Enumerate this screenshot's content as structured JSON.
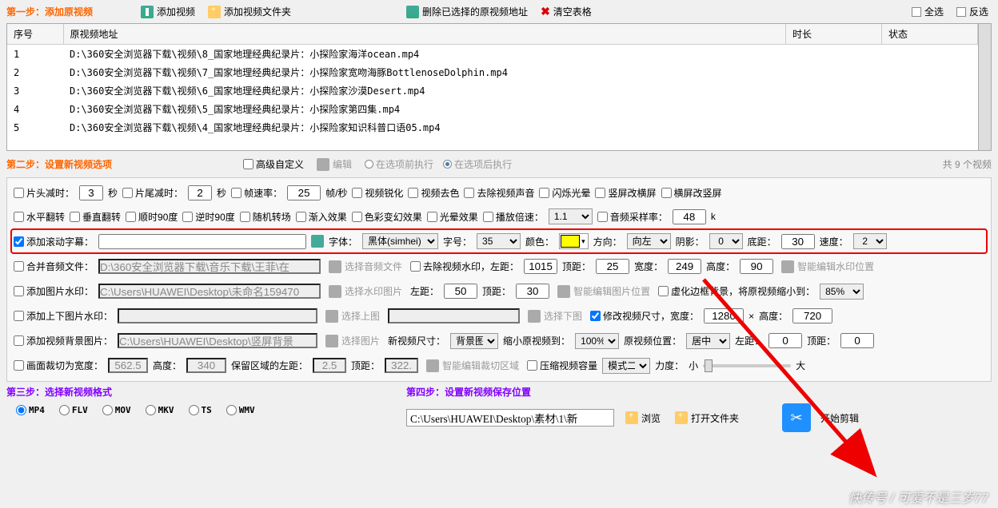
{
  "toolbar": {
    "step1": "第一步：添加原视频",
    "add_video": "添加视频",
    "add_folder": "添加视频文件夹",
    "delete_selected": "删除已选择的原视频地址",
    "clear_table": "清空表格",
    "select_all": "全选",
    "invert_sel": "反选"
  },
  "table": {
    "headers": {
      "num": "序号",
      "path": "原视频地址",
      "duration": "时长",
      "status": "状态"
    },
    "rows": [
      {
        "n": "1",
        "p": "D:\\360安全浏览器下载\\视频\\8_国家地理经典纪录片：小探险家海洋ocean.mp4"
      },
      {
        "n": "2",
        "p": "D:\\360安全浏览器下载\\视频\\7_国家地理经典纪录片：小探险家宽吻海豚BottlenoseDolphin.mp4"
      },
      {
        "n": "3",
        "p": "D:\\360安全浏览器下载\\视频\\6_国家地理经典纪录片：小探险家沙漠Desert.mp4"
      },
      {
        "n": "4",
        "p": "D:\\360安全浏览器下载\\视频\\5_国家地理经典纪录片：小探险家第四集.mp4"
      },
      {
        "n": "5",
        "p": "D:\\360安全浏览器下载\\视频\\4_国家地理经典纪录片：小探险家知识科普口语05.mp4"
      }
    ]
  },
  "step2": {
    "label": "第二步：设置新视频选项",
    "advanced": "高级自定义",
    "edit": "编辑",
    "exec_before": "在选项前执行",
    "exec_after": "在选项后执行",
    "count": "共 9 个视频"
  },
  "opts": {
    "head_trim": "片头减时：",
    "head_val": "3",
    "sec": "秒",
    "tail_trim": "片尾减时：",
    "tail_val": "2",
    "fps_lbl": "帧速率：",
    "fps_val": "25",
    "fps_unit": "帧/秒",
    "sharpen": "视频锐化",
    "desat": "视频去色",
    "mute": "去除视频声音",
    "flash": "闪烁光晕",
    "v2h": "竖屏改横屏",
    "h2v": "横屏改竖屏",
    "hflip": "水平翻转",
    "vflip": "垂直翻转",
    "cw90": "顺时90度",
    "ccw90": "逆时90度",
    "rand_trans": "随机转场",
    "in_effect": "渐入效果",
    "color_fx": "色彩变幻效果",
    "halo": "光晕效果",
    "speed_lbl": "播放倍速：",
    "speed_val": "1.1",
    "audio_rate_lbl": "音频采样率：",
    "audio_rate_val": "48",
    "audio_rate_unit": "k",
    "scroll_sub": "添加滚动字幕：",
    "font_lbl": "字体：",
    "font_val": "黑体(simhei)",
    "size_lbl": "字号：",
    "size_val": "35",
    "color_lbl": "颜色：",
    "dir_lbl": "方向：",
    "dir_val": "向左",
    "shadow_lbl": "阴影：",
    "shadow_val": "0",
    "bottom_lbl": "底距：",
    "bottom_val": "30",
    "scroll_speed_lbl": "速度：",
    "scroll_speed_val": "2",
    "merge_audio": "合并音频文件：",
    "audio_path": "D:\\360安全浏览器下载\\音乐下载\\王菲\\在",
    "sel_audio": "选择音频文件",
    "rm_wm": "去除视频水印，左距：",
    "wm_l": "1015",
    "wm_t_lbl": "顶距：",
    "wm_t": "25",
    "wm_w_lbl": "宽度：",
    "wm_w": "249",
    "wm_h_lbl": "高度：",
    "wm_h": "90",
    "smart_wm": "智能编辑水印位置",
    "img_wm": "添加图片水印：",
    "img_wm_path": "C:\\Users\\HUAWEI\\Desktop\\未命名159470",
    "sel_wm_img": "选择水印图片",
    "left_lbl": "左距：",
    "left_v": "50",
    "top_v": "30",
    "smart_img": "智能编辑图片位置",
    "blur_bg": "虚化边框背景，将原视频缩小到：",
    "blur_pct": "85%",
    "tb_img_wm": "添加上下图片水印：",
    "sel_top": "选择上图",
    "sel_bot": "选择下图",
    "resize": "修改视频尺寸，宽度：",
    "rw": "1280",
    "x": "×",
    "rh_lbl": "高度：",
    "rh": "720",
    "bg_img": "添加视频背景图片：",
    "bg_path": "C:\\Users\\HUAWEI\\Desktop\\竖屏背景",
    "sel_img": "选择图片",
    "new_size": "新视频尺寸：",
    "bg_sel": "背景图",
    "shrink": "缩小原视频到：",
    "shrink_v": "100%",
    "orig_pos": "原视频位置：",
    "center": "居中",
    "l2": "左距：",
    "l2v": "0",
    "t2": "顶距：",
    "t2v": "0",
    "crop_w": "画面裁切为宽度：",
    "crop_wv": "562.5",
    "crop_h": "高度：",
    "crop_hv": "340",
    "keep_l": "保留区域的左距：",
    "keep_lv": "2.5",
    "keep_t": "顶距：",
    "keep_tv": "322.",
    "smart_crop": "智能编辑裁切区域",
    "compress": "压缩视频容量",
    "mode2": "模式二",
    "force": "力度：",
    "small": "小",
    "big": "大"
  },
  "step3": {
    "label": "第三步：选择新视频格式",
    "formats": [
      "MP4",
      "FLV",
      "MOV",
      "MKV",
      "TS",
      "WMV"
    ]
  },
  "step4": {
    "label": "第四步：设置新视频保存位置",
    "path": "C:\\Users\\HUAWEI\\Desktop\\素材\\1\\新",
    "browse": "浏览",
    "open_folder": "打开文件夹",
    "start": "开始剪辑"
  },
  "watermark": "快传号 / 可爱不是三岁77"
}
